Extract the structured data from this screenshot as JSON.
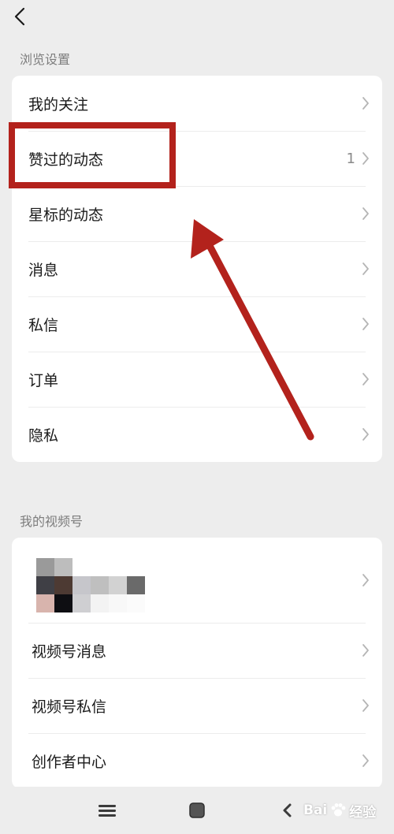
{
  "browse_section": {
    "title": "浏览设置",
    "items": [
      {
        "label": "我的关注",
        "count": ""
      },
      {
        "label": "赞过的动态",
        "count": "1"
      },
      {
        "label": "星标的动态",
        "count": ""
      },
      {
        "label": "消息",
        "count": ""
      },
      {
        "label": "私信",
        "count": ""
      },
      {
        "label": "订单",
        "count": ""
      },
      {
        "label": "隐私",
        "count": ""
      }
    ]
  },
  "channels_section": {
    "title": "我的视频号",
    "items": [
      {
        "label": "视频号消息"
      },
      {
        "label": "视频号私信"
      },
      {
        "label": "创作者中心"
      }
    ]
  },
  "icons": {
    "back": "back-chevron-icon",
    "chevron": "chevron-right-icon",
    "menu": "menu-icon",
    "home": "home-square-icon",
    "nav_back": "nav-back-icon"
  },
  "colors": {
    "annotation_red": "#b3221c",
    "background": "#ededed"
  },
  "watermark": {
    "text": "Bai",
    "suffix": "经验"
  }
}
